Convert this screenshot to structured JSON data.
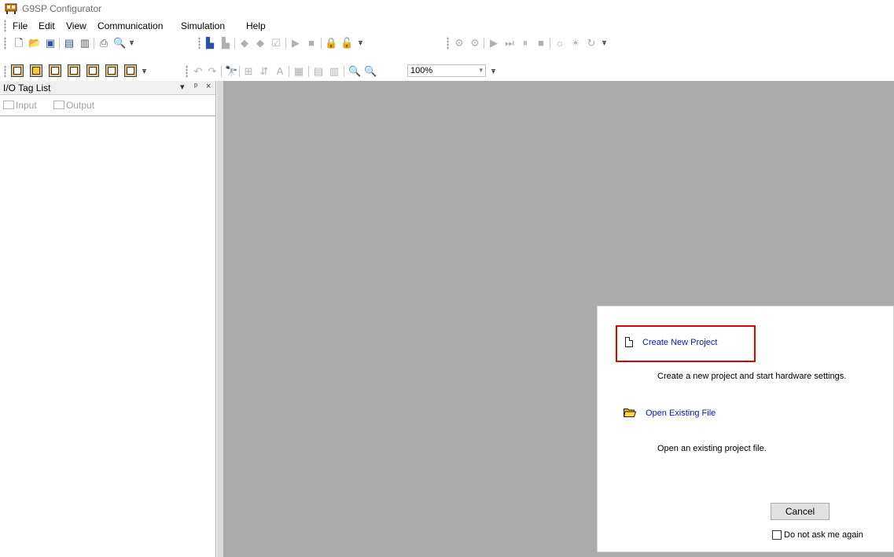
{
  "window": {
    "title": "G9SP Configurator"
  },
  "menu": {
    "items": [
      "File",
      "Edit",
      "View",
      "Communication",
      "Simulation",
      "Help"
    ]
  },
  "toolbar": {
    "zoom_value": "100%"
  },
  "panel": {
    "title": "I/O Tag List",
    "dropdown_glyph": "▾",
    "pin_glyph": "ᵖ",
    "close_glyph": "×",
    "tabs": [
      "Input",
      "Output"
    ]
  },
  "dialog": {
    "create": {
      "label": "Create New Project",
      "description": "Create a new project and start hardware settings."
    },
    "open": {
      "label": "Open Existing File",
      "description": "Open an existing project file."
    },
    "cancel_label": "Cancel",
    "checkbox_label": "Do not ask me again",
    "highlight_color": "#e00000",
    "link_color": "#0018c8"
  },
  "colors": {
    "workspace": "#ababab",
    "toolbar_box_accent": "#f6c840"
  }
}
